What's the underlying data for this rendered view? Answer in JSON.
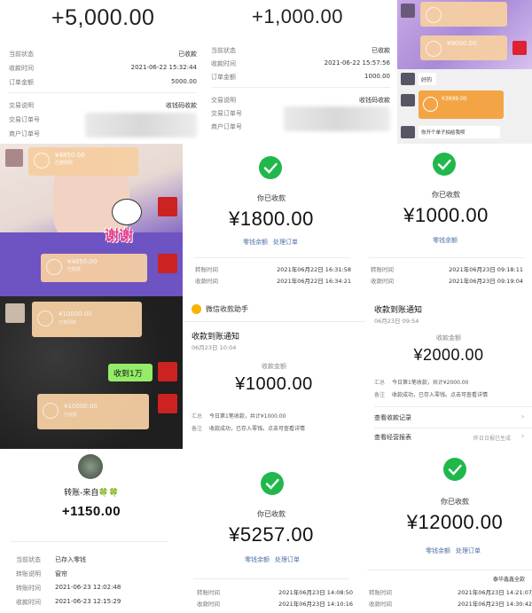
{
  "p1": {
    "amount": "+5,000.00",
    "rows": [
      {
        "label": "当前状态",
        "value": "已收款"
      },
      {
        "label": "收款时间",
        "value": "2021-06-22 15:32:44"
      },
      {
        "label": "订单金额",
        "value": "5000.00"
      },
      {
        "label": "交易说明",
        "value": "收钱码收款"
      },
      {
        "label": "交易订单号",
        "value": ""
      },
      {
        "label": "商户订单号",
        "value": ""
      }
    ]
  },
  "p2": {
    "amount": "+1,000.00",
    "rows": [
      {
        "label": "当前状态",
        "value": "已收款"
      },
      {
        "label": "收款时间",
        "value": "2021-06-22 15:57:56"
      },
      {
        "label": "订单金额",
        "value": "1000.00"
      },
      {
        "label": "交易说明",
        "value": "收钱码收款"
      },
      {
        "label": "交易订单号",
        "value": ""
      },
      {
        "label": "商户订单号",
        "value": ""
      }
    ]
  },
  "p3": {
    "bubble_amount": "¥9000.00",
    "reply": "好的",
    "orange_amount": "¥3899.00",
    "message": "你开个单子拍给我呗"
  },
  "p4": {
    "bubble1_amount": "¥4850.00",
    "bubble1_sub": "已被领取",
    "sticker_text": "谢谢",
    "bubble2_amount": "¥4850.00",
    "bubble2_sub": "已收款"
  },
  "p5": {
    "title": "你已收款",
    "amount": "¥1800.00",
    "link1": "零钱余额",
    "link2": "处理订单",
    "rows": [
      {
        "label": "转账时间",
        "value": "2021年06月22日 16:31:58"
      },
      {
        "label": "收款时间",
        "value": "2021年06月22日 16:34:21"
      }
    ]
  },
  "p6": {
    "title": "你已收款",
    "amount": "¥1000.00",
    "link1": "零钱余额",
    "rows": [
      {
        "label": "转账时间",
        "value": "2021年06月23日 09:18:11"
      },
      {
        "label": "收款时间",
        "value": "2021年06月23日 09:19:04"
      }
    ]
  },
  "p7": {
    "bubble1_amount": "¥10000.00",
    "bubble1_sub": "已被领取",
    "message": "收到1万",
    "bubble2_amount": "¥10000.00",
    "bubble2_sub": "已收款"
  },
  "p8": {
    "header": "微信收款助手",
    "notice_title": "收款到账通知",
    "date": "06月23日 10:04",
    "amount_label": "收款金额",
    "amount": "¥1000.00",
    "summary_label": "汇总",
    "summary_value": "今日第1笔收款，共计¥1000.00",
    "remark_label": "备注",
    "remark_value": "收款成功，已存入零钱。点击可查看详情"
  },
  "p9": {
    "notice_title": "收款到账通知",
    "date": "06月23日 09:54",
    "amount_label": "收款金额",
    "amount": "¥2000.00",
    "summary_label": "汇总",
    "summary_value": "今日第1笔收款，共计¥2000.00",
    "remark_label": "备注",
    "remark_value": "收款成功，已存入零钱。点击可查看详情",
    "link1": "查看收款记录",
    "link2": "查看经营报表",
    "link2_right": "昨日日报已生成"
  },
  "p10": {
    "title": "转账-来自🍀🍀",
    "amount": "+1150.00",
    "rows": [
      {
        "label": "当前状态",
        "value": "已存入零钱"
      },
      {
        "label": "转账说明",
        "value": "窗帘"
      },
      {
        "label": "转账时间",
        "value": "2021-06-23 12:02:48"
      },
      {
        "label": "收款时间",
        "value": "2021-06-23 12:15:29"
      }
    ]
  },
  "p11": {
    "title": "你已收款",
    "amount": "¥5257.00",
    "link1": "零钱余额",
    "link2": "处理订单",
    "rows": [
      {
        "label": "转账时间",
        "value": "2021年06月23日 14:08:50"
      },
      {
        "label": "收款时间",
        "value": "2021年06月23日 14:10:16"
      }
    ]
  },
  "p12": {
    "title": "你已收款",
    "amount": "¥12000.00",
    "link1": "零钱余额",
    "link2": "处理订单",
    "top_right": "泰华鑫鑫全款",
    "rows": [
      {
        "label": "转账时间",
        "value": "2021年06月23日 14:21:07"
      },
      {
        "label": "收款时间",
        "value": "2021年06月23日 14:30:42"
      }
    ]
  }
}
